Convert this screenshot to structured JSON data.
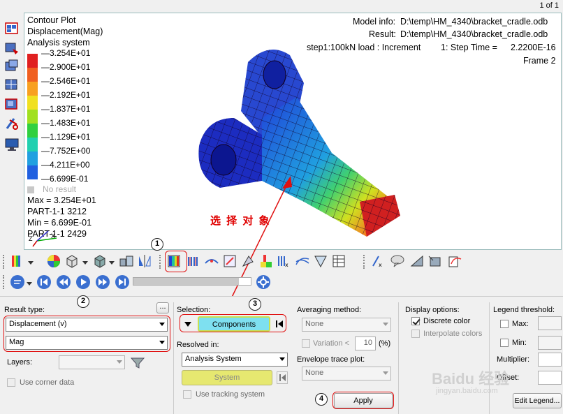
{
  "page_indicator": "1 of 1",
  "viewport": {
    "title_lines": [
      "Contour Plot",
      "Displacement(Mag)",
      "Analysis system"
    ],
    "model_info_label": "Model info:",
    "model_info_value": "D:\\temp\\HM_4340\\bracket_cradle.odb",
    "result_label": "Result:",
    "result_value": "D:\\temp\\HM_4340\\bracket_cradle.odb",
    "step_text": "step1:100kN load : Increment",
    "step_time_text": "1: Step Time =",
    "step_time_value": "2.2200E-16",
    "frame_text": "Frame 2",
    "legend": {
      "labels": [
        "3.254E+01",
        "2.900E+01",
        "2.546E+01",
        "2.192E+01",
        "1.837E+01",
        "1.483E+01",
        "1.129E+01",
        "7.752E+00",
        "4.211E+00",
        "6.699E-01"
      ],
      "colors": [
        "#e02020",
        "#f06020",
        "#f8a020",
        "#f0e020",
        "#a0e020",
        "#30d040",
        "#20d0b0",
        "#20a0e0",
        "#2060e0",
        "#1010b0"
      ],
      "no_result": "No result"
    },
    "max_text": "Max = 3.254E+01",
    "max_part": "PART-1-1 3212",
    "min_text": "Min = 6.699E-01",
    "min_part": "PART-1-1 2429",
    "axis_x": "X",
    "axis_z": "Z",
    "annotation": "选 择 对 象"
  },
  "toolbar2": {
    "progress": 0.9
  },
  "panel": {
    "result_type_label": "Result type:",
    "browse_button": "...",
    "result_type_value": "Displacement (v)",
    "component_value": "Mag",
    "layers_label": "Layers:",
    "use_corner_data": "Use corner data",
    "selection_label": "Selection:",
    "components_button": "Components",
    "resolved_in_label": "Resolved in:",
    "resolved_in_value": "Analysis System",
    "system_button": "System",
    "use_tracking_system": "Use tracking system",
    "averaging_label": "Averaging method:",
    "averaging_value": "None",
    "variation_label": "Variation <",
    "variation_value": "10",
    "variation_unit": "(%)",
    "envelope_label": "Envelope trace plot:",
    "envelope_value": "None",
    "apply_button": "Apply",
    "display_options_label": "Display options:",
    "discrete_color": "Discrete color",
    "interpolate_colors": "Interpolate colors",
    "legend_threshold_label": "Legend threshold:",
    "max_label": "Max:",
    "min_label": "Min:",
    "multiplier_label": "Multiplier:",
    "offset_label": "Offset:",
    "edit_legend_button": "Edit Legend..."
  },
  "callouts": [
    "1",
    "2",
    "3",
    "4"
  ],
  "watermark": "Baidu 经验",
  "watermark_url": "jingyan.baidu.com"
}
